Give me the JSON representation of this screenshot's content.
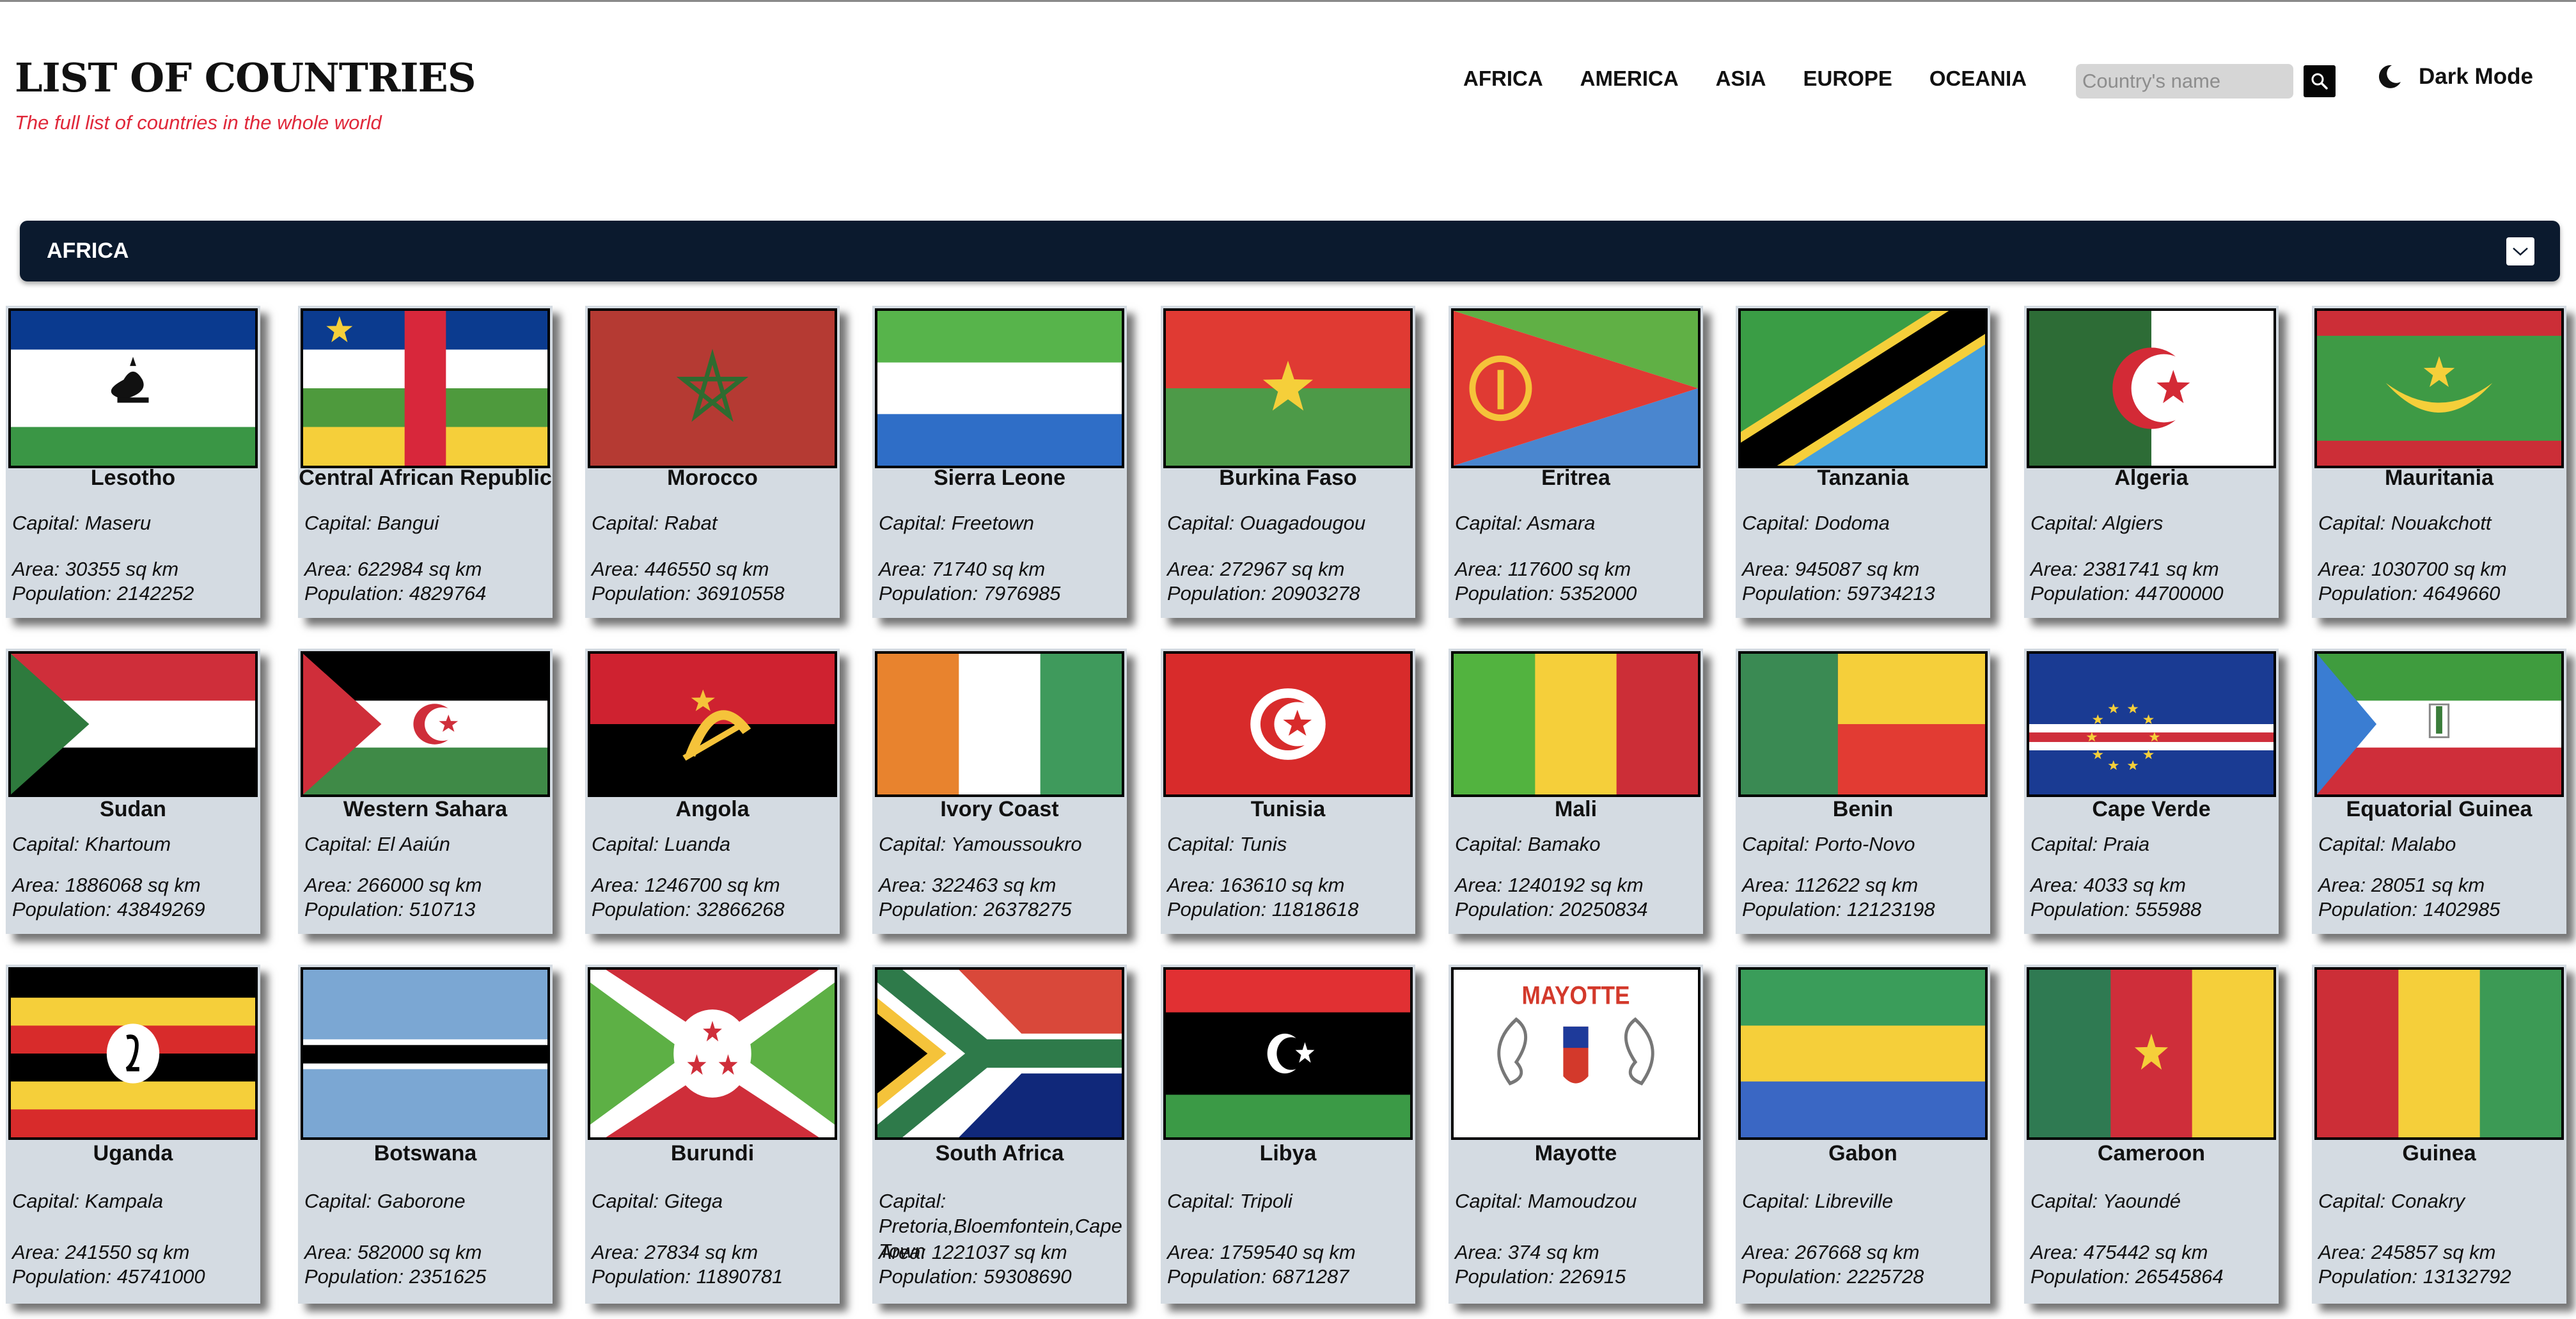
{
  "header": {
    "title": "LIST OF COUNTRIES",
    "subtitle": "The full list of countries in the whole world"
  },
  "nav": [
    "AFRICA",
    "AMERICA",
    "ASIA",
    "EUROPE",
    "OCEANIA"
  ],
  "search": {
    "placeholder": "Country's name",
    "icon": "search-icon"
  },
  "theme_toggle": {
    "label": "Dark Mode",
    "icon": "moon-icon"
  },
  "region": {
    "label": "AFRICA",
    "icon": "chevron-down-icon"
  },
  "colors": {
    "region_bar": "#0b1a2e",
    "subtitle": "#e0283a",
    "card_bg": "#d4dbe2"
  },
  "countries": [
    {
      "name": "Lesotho",
      "capital": "Capital: Maseru",
      "area": "Area: 30355 sq km",
      "population": "Population: 2142252"
    },
    {
      "name": "Central African Republic",
      "capital": "Capital: Bangui",
      "area": "Area: 622984 sq km",
      "population": "Population: 4829764"
    },
    {
      "name": "Morocco",
      "capital": "Capital: Rabat",
      "area": "Area: 446550 sq km",
      "population": "Population: 36910558"
    },
    {
      "name": "Sierra Leone",
      "capital": "Capital: Freetown",
      "area": "Area: 71740 sq km",
      "population": "Population: 7976985"
    },
    {
      "name": "Burkina Faso",
      "capital": "Capital: Ouagadougou",
      "area": "Area: 272967 sq km",
      "population": "Population: 20903278"
    },
    {
      "name": "Eritrea",
      "capital": "Capital: Asmara",
      "area": "Area: 117600 sq km",
      "population": "Population: 5352000"
    },
    {
      "name": "Tanzania",
      "capital": "Capital: Dodoma",
      "area": "Area: 945087 sq km",
      "population": "Population: 59734213"
    },
    {
      "name": "Algeria",
      "capital": "Capital: Algiers",
      "area": "Area: 2381741 sq km",
      "population": "Population: 44700000"
    },
    {
      "name": "Mauritania",
      "capital": "Capital: Nouakchott",
      "area": "Area: 1030700 sq km",
      "population": "Population: 4649660"
    },
    {
      "name": "Sudan",
      "capital": "Capital: Khartoum",
      "area": "Area: 1886068 sq km",
      "population": "Population: 43849269"
    },
    {
      "name": "Western Sahara",
      "capital": "Capital: El Aaiún",
      "area": "Area: 266000 sq km",
      "population": "Population: 510713"
    },
    {
      "name": "Angola",
      "capital": "Capital: Luanda",
      "area": "Area: 1246700 sq km",
      "population": "Population: 32866268"
    },
    {
      "name": "Ivory Coast",
      "capital": "Capital: Yamoussoukro",
      "area": "Area: 322463 sq km",
      "population": "Population: 26378275"
    },
    {
      "name": "Tunisia",
      "capital": "Capital: Tunis",
      "area": "Area: 163610 sq km",
      "population": "Population: 11818618"
    },
    {
      "name": "Mali",
      "capital": "Capital: Bamako",
      "area": "Area: 1240192 sq km",
      "population": "Population: 20250834"
    },
    {
      "name": "Benin",
      "capital": "Capital: Porto-Novo",
      "area": "Area: 112622 sq km",
      "population": "Population: 12123198"
    },
    {
      "name": "Cape Verde",
      "capital": "Capital: Praia",
      "area": "Area: 4033 sq km",
      "population": "Population: 555988"
    },
    {
      "name": "Equatorial Guinea",
      "capital": "Capital: Malabo",
      "area": "Area: 28051 sq km",
      "population": "Population: 1402985"
    },
    {
      "name": "Uganda",
      "capital": "Capital: Kampala",
      "area": "Area: 241550 sq km",
      "population": "Population: 45741000"
    },
    {
      "name": "Botswana",
      "capital": "Capital: Gaborone",
      "area": "Area: 582000 sq km",
      "population": "Population: 2351625"
    },
    {
      "name": "Burundi",
      "capital": "Capital: Gitega",
      "area": "Area: 27834 sq km",
      "population": "Population: 11890781"
    },
    {
      "name": "South Africa",
      "capital": "Capital: Pretoria,Bloemfontein,Cape Town",
      "area": "Area: 1221037 sq km",
      "population": "Population: 59308690"
    },
    {
      "name": "Libya",
      "capital": "Capital: Tripoli",
      "area": "Area: 1759540 sq km",
      "population": "Population: 6871287"
    },
    {
      "name": "Mayotte",
      "capital": "Capital: Mamoudzou",
      "area": "Area: 374 sq km",
      "population": "Population: 226915",
      "flag_text": "MAYOTTE"
    },
    {
      "name": "Gabon",
      "capital": "Capital: Libreville",
      "area": "Area: 267668 sq km",
      "population": "Population: 2225728"
    },
    {
      "name": "Cameroon",
      "capital": "Capital: Yaoundé",
      "area": "Area: 475442 sq km",
      "population": "Population: 26545864"
    },
    {
      "name": "Guinea",
      "capital": "Capital: Conakry",
      "area": "Area: 245857 sq km",
      "population": "Population: 13132792"
    }
  ]
}
